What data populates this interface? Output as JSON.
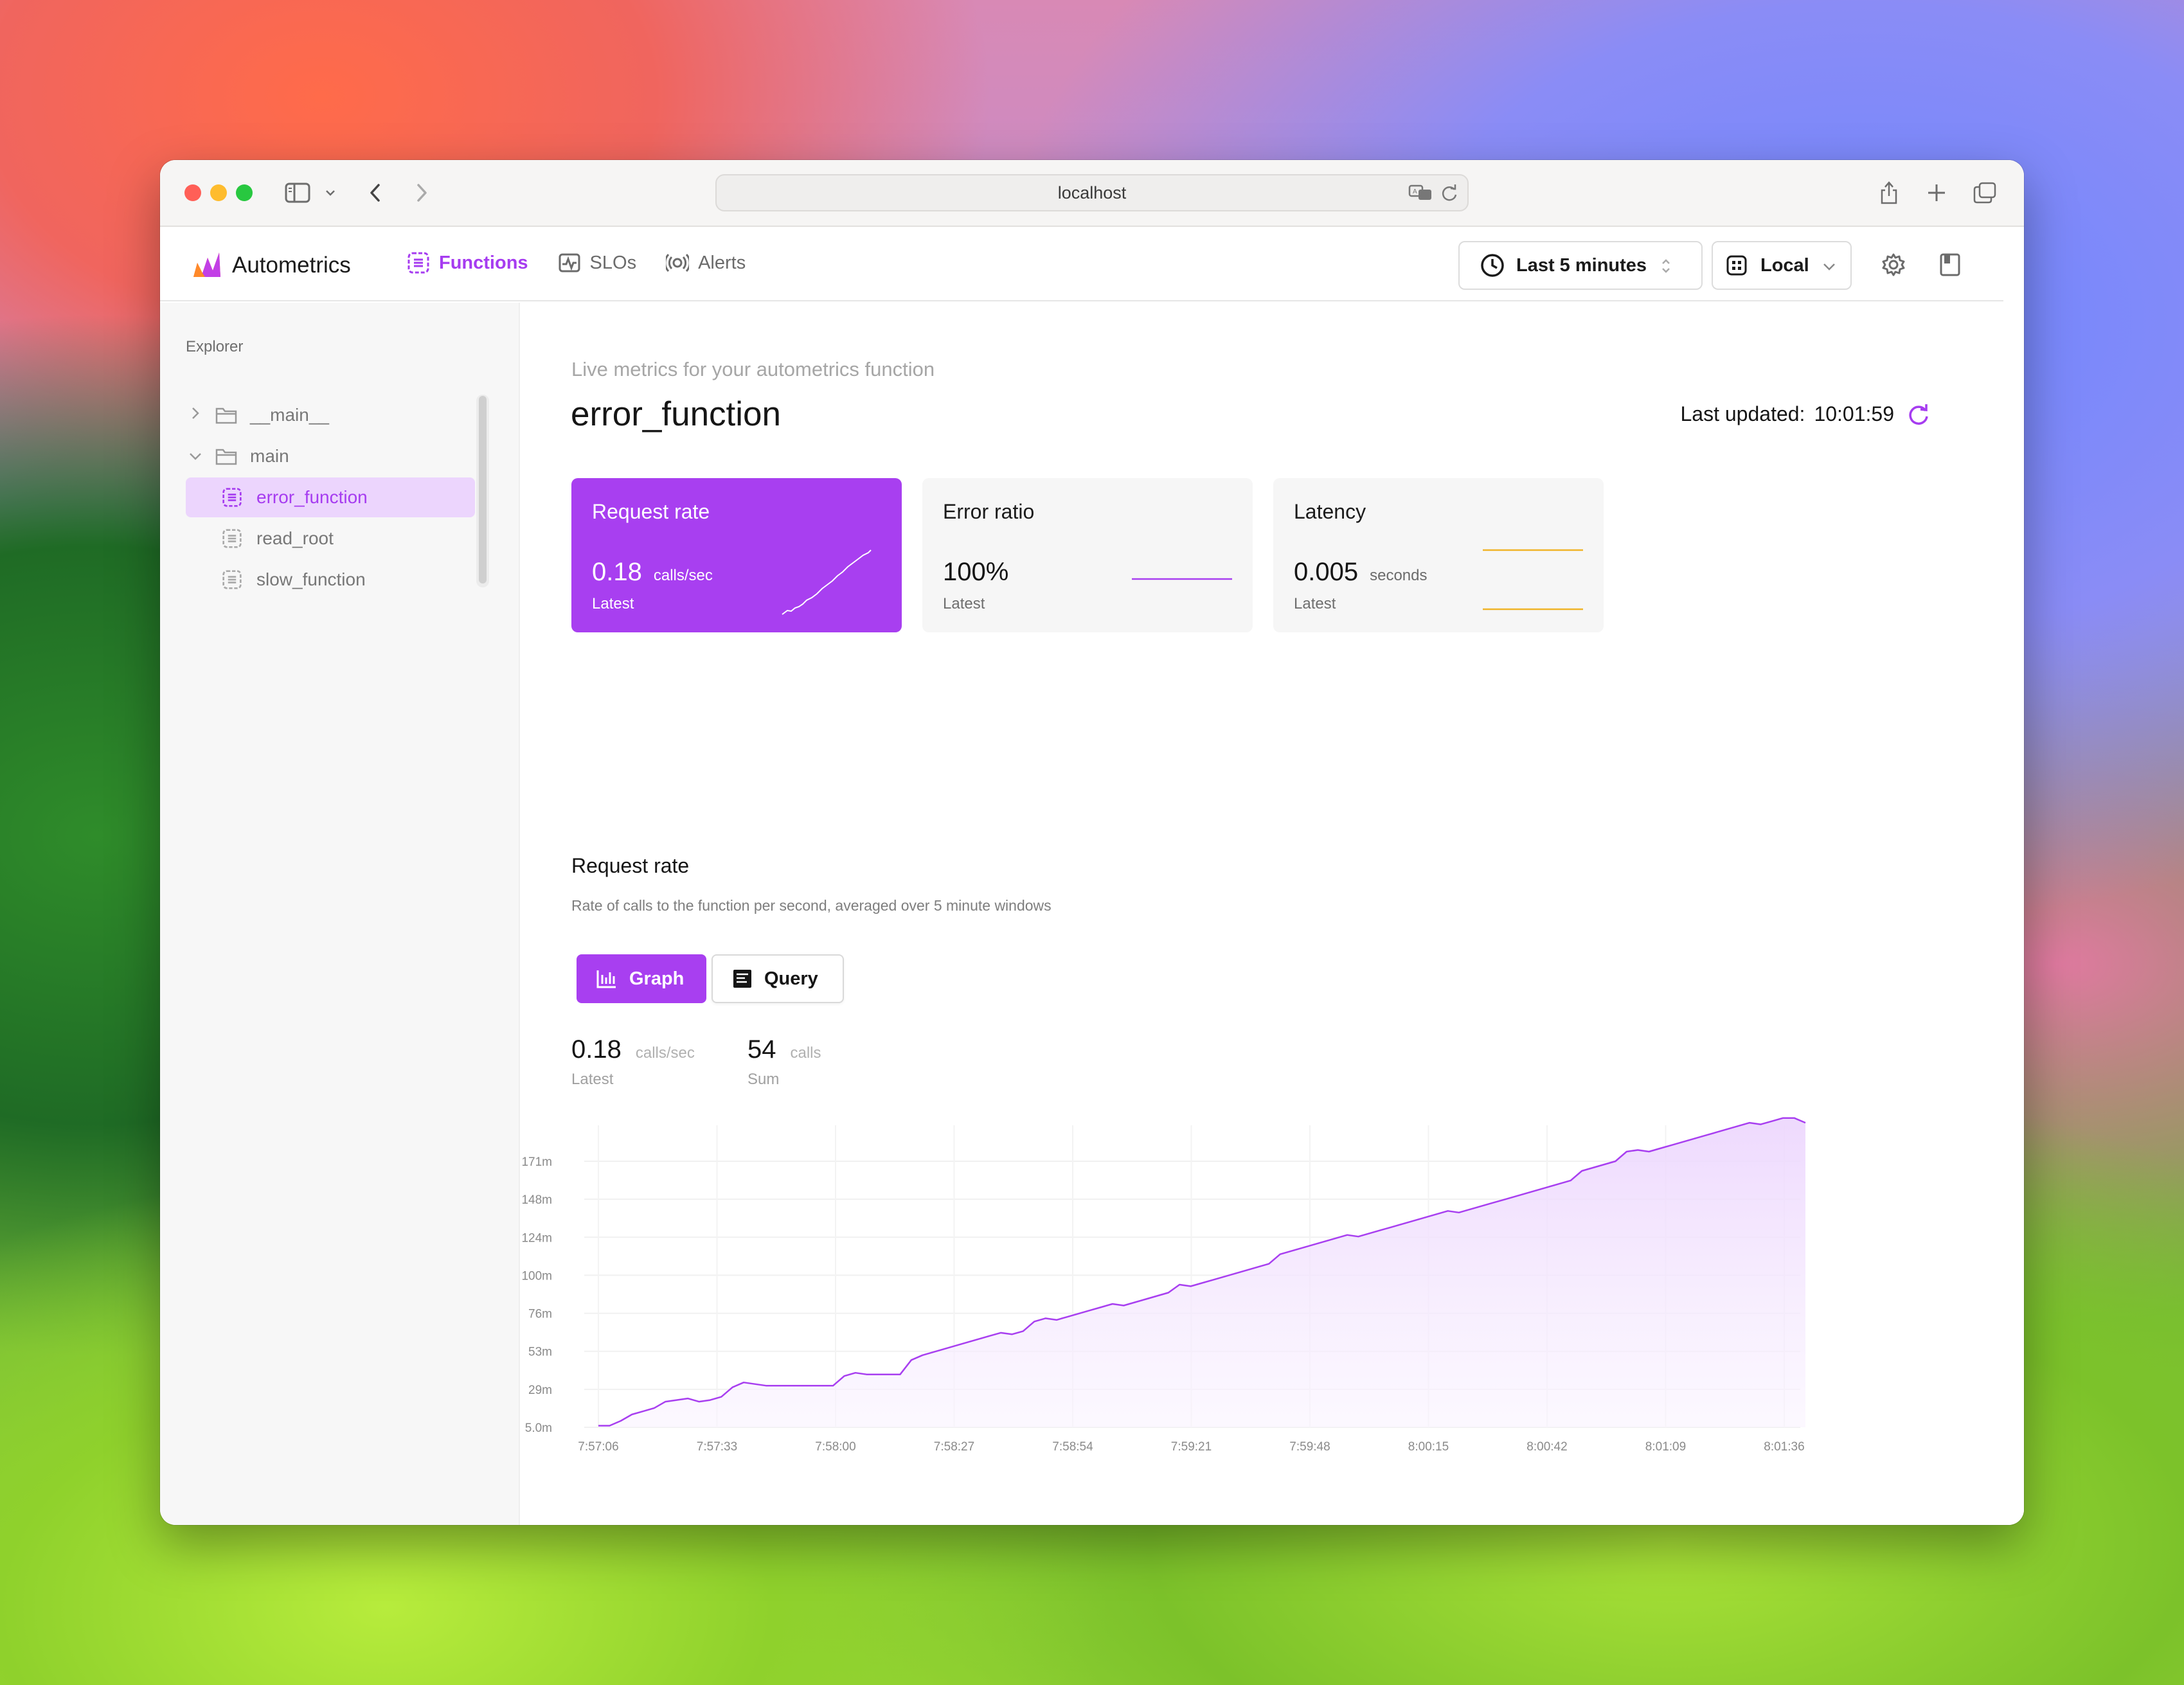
{
  "browser": {
    "url": "localhost"
  },
  "app": {
    "name": "Autometrics",
    "nav": [
      {
        "label": "Functions",
        "icon": "function-icon",
        "active": true
      },
      {
        "label": "SLOs",
        "icon": "slo-icon",
        "active": false
      },
      {
        "label": "Alerts",
        "icon": "alert-icon",
        "active": false
      }
    ],
    "time_range": "Last 5 minutes",
    "environment": "Local"
  },
  "sidebar": {
    "label": "Explorer",
    "items": [
      {
        "label": "__main__",
        "type": "folder",
        "expanded": false
      },
      {
        "label": "main",
        "type": "folder",
        "expanded": true
      },
      {
        "label": "error_function",
        "type": "function",
        "active": true
      },
      {
        "label": "read_root",
        "type": "function",
        "active": false
      },
      {
        "label": "slow_function",
        "type": "function",
        "active": false
      }
    ]
  },
  "page": {
    "subtitle": "Live metrics for your autometrics function",
    "title": "error_function",
    "last_updated_label": "Last updated:",
    "last_updated_value": "10:01:59"
  },
  "cards": [
    {
      "title": "Request rate",
      "value": "0.18",
      "unit": "calls/sec",
      "sub": "Latest"
    },
    {
      "title": "Error ratio",
      "value": "100%",
      "unit": "",
      "sub": "Latest"
    },
    {
      "title": "Latency",
      "value": "0.005",
      "unit": "seconds",
      "sub": "Latest"
    }
  ],
  "section": {
    "title": "Request rate",
    "description": "Rate of calls to the function per second, averaged over 5 minute windows"
  },
  "tabs": {
    "graph": "Graph",
    "query": "Query"
  },
  "stats": [
    {
      "value": "0.18",
      "unit": "calls/sec",
      "label": "Latest"
    },
    {
      "value": "54",
      "unit": "calls",
      "label": "Sum"
    }
  ],
  "colors": {
    "accent": "#a83ff0",
    "latency": "#f0b429"
  },
  "chart_data": {
    "type": "area",
    "title": "",
    "xlabel": "",
    "ylabel": "",
    "y_tick_labels": [
      "5.0m",
      "29m",
      "53m",
      "76m",
      "100m",
      "124m",
      "148m",
      "171m"
    ],
    "x_tick_labels": [
      "7:57:06",
      "7:57:33",
      "7:58:00",
      "7:58:27",
      "7:58:54",
      "7:59:21",
      "7:59:48",
      "8:00:15",
      "8:00:42",
      "8:01:09",
      "8:01:36"
    ],
    "ylim": [
      5.0,
      171
    ],
    "grid": true,
    "series": [
      {
        "values": [
          6,
          6,
          9,
          13,
          15,
          17,
          21,
          22,
          23,
          21,
          22,
          24,
          30,
          33,
          32,
          31,
          31,
          31,
          31,
          31,
          31,
          31,
          37,
          39,
          38,
          38,
          38,
          38,
          47,
          50,
          52,
          54,
          56,
          58,
          60,
          62,
          64,
          63,
          65,
          71,
          73,
          72,
          74,
          76,
          78,
          80,
          82,
          81,
          83,
          85,
          87,
          89,
          94,
          93,
          95,
          97,
          99,
          101,
          103,
          105,
          107,
          113,
          115,
          117,
          119,
          121,
          123,
          125,
          124,
          126,
          128,
          130,
          132,
          134,
          136,
          138,
          140,
          139,
          141,
          143,
          145,
          147,
          149,
          151,
          153,
          155,
          157,
          159,
          165,
          167,
          169,
          171,
          177,
          178,
          177,
          179,
          181,
          183,
          185,
          187,
          189,
          191,
          193,
          195,
          194,
          196,
          198,
          198,
          195
        ]
      }
    ]
  }
}
